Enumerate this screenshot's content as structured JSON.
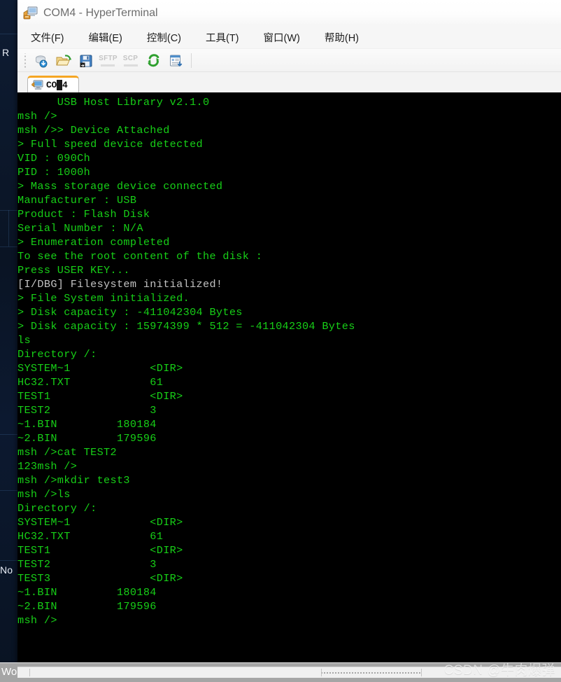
{
  "window": {
    "title": "COM4 - HyperTerminal",
    "icon": "computer-network-icon"
  },
  "menubar": {
    "items": [
      {
        "label": "文件(F)",
        "name": "menu-file"
      },
      {
        "label": "编辑(E)",
        "name": "menu-edit"
      },
      {
        "label": "控制(C)",
        "name": "menu-control"
      },
      {
        "label": "工具(T)",
        "name": "menu-tools"
      },
      {
        "label": "窗口(W)",
        "name": "menu-window"
      },
      {
        "label": "帮助(H)",
        "name": "menu-help"
      }
    ]
  },
  "toolbar": {
    "buttons": [
      {
        "name": "connect-icon",
        "label": "",
        "disabled": false
      },
      {
        "name": "open-folder-icon",
        "label": "",
        "disabled": false
      },
      {
        "name": "save-icon",
        "label": "",
        "disabled": false
      },
      {
        "name": "sftp-icon",
        "label": "SFTP",
        "disabled": true
      },
      {
        "name": "scp-icon",
        "label": "SCP",
        "disabled": true
      },
      {
        "name": "reconnect-icon",
        "label": "",
        "disabled": false
      },
      {
        "name": "log-export-icon",
        "label": "",
        "disabled": false
      }
    ]
  },
  "tabs": [
    {
      "label": "COM4",
      "name": "tab-com4",
      "active": true
    }
  ],
  "terminal": {
    "foreground": "#17d017",
    "background": "#000000",
    "debug_color": "#c3c3c3",
    "lines": [
      {
        "text": "      USB Host Library v2.1.0",
        "style": "normal"
      },
      {
        "text": "msh />",
        "style": "normal"
      },
      {
        "text": "msh />> Device Attached",
        "style": "normal"
      },
      {
        "text": "> Full speed device detected",
        "style": "normal"
      },
      {
        "text": "VID : 090Ch",
        "style": "normal"
      },
      {
        "text": "PID : 1000h",
        "style": "normal"
      },
      {
        "text": "> Mass storage device connected",
        "style": "normal"
      },
      {
        "text": "Manufacturer : USB",
        "style": "normal"
      },
      {
        "text": "Product : Flash Disk",
        "style": "normal"
      },
      {
        "text": "Serial Number : N/A",
        "style": "normal"
      },
      {
        "text": "> Enumeration completed",
        "style": "normal"
      },
      {
        "text": "To see the root content of the disk :",
        "style": "normal"
      },
      {
        "text": "Press USER KEY...",
        "style": "normal"
      },
      {
        "text": "[I/DBG] Filesystem initialized!",
        "style": "debug"
      },
      {
        "text": "> File System initialized.",
        "style": "normal"
      },
      {
        "text": "> Disk capacity : -411042304 Bytes",
        "style": "normal"
      },
      {
        "text": "> Disk capacity : 15974399 * 512 = -411042304 Bytes",
        "style": "normal"
      },
      {
        "text": "ls",
        "style": "normal"
      },
      {
        "text": "Directory /:",
        "style": "normal"
      },
      {
        "text": "SYSTEM~1            <DIR>",
        "style": "normal"
      },
      {
        "text": "HC32.TXT            61",
        "style": "normal"
      },
      {
        "text": "TEST1               <DIR>",
        "style": "normal"
      },
      {
        "text": "TEST2               3",
        "style": "normal"
      },
      {
        "text": "~1.BIN         180184",
        "style": "normal"
      },
      {
        "text": "~2.BIN         179596",
        "style": "normal"
      },
      {
        "text": "msh />cat TEST2",
        "style": "normal"
      },
      {
        "text": "123msh />",
        "style": "normal"
      },
      {
        "text": "msh />mkdir test3",
        "style": "normal"
      },
      {
        "text": "msh />ls",
        "style": "normal"
      },
      {
        "text": "Directory /:",
        "style": "normal"
      },
      {
        "text": "SYSTEM~1            <DIR>",
        "style": "normal"
      },
      {
        "text": "HC32.TXT            61",
        "style": "normal"
      },
      {
        "text": "TEST1               <DIR>",
        "style": "normal"
      },
      {
        "text": "TEST2               3",
        "style": "normal"
      },
      {
        "text": "TEST3               <DIR>",
        "style": "normal"
      },
      {
        "text": "~1.BIN         180184",
        "style": "normal"
      },
      {
        "text": "~2.BIN         179596",
        "style": "normal"
      },
      {
        "text": "msh />",
        "style": "normal"
      }
    ]
  },
  "background": {
    "labels": [
      {
        "text": "R",
        "name": "bg-label-r"
      },
      {
        "text": "No",
        "name": "bg-label-no"
      },
      {
        "text": "Wo",
        "name": "bg-label-wo"
      }
    ]
  },
  "watermark": {
    "text": "CSDN @牛肉爆弹"
  }
}
